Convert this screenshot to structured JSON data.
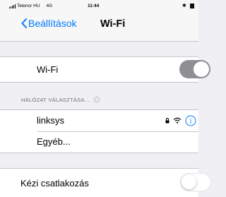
{
  "status_bar": {
    "carrier": "Telenor HU",
    "network": "4G",
    "time": "11:44"
  },
  "nav": {
    "back_label": "Beállítások",
    "title": "Wi-Fi"
  },
  "wifi_cell": {
    "label": "Wi-Fi",
    "enabled": true
  },
  "networks_section": {
    "header": "HÁLÓZAT VÁLASZTÁSA..."
  },
  "networks": [
    {
      "name": "linksys",
      "secured": true
    }
  ],
  "other_label": "Egyéb...",
  "manual_connect": {
    "label": "Kézi csatlakozás",
    "enabled": false
  },
  "colors": {
    "accent": "#007aff",
    "toggle_on": "#8e8e93",
    "background": "#efeff4"
  }
}
